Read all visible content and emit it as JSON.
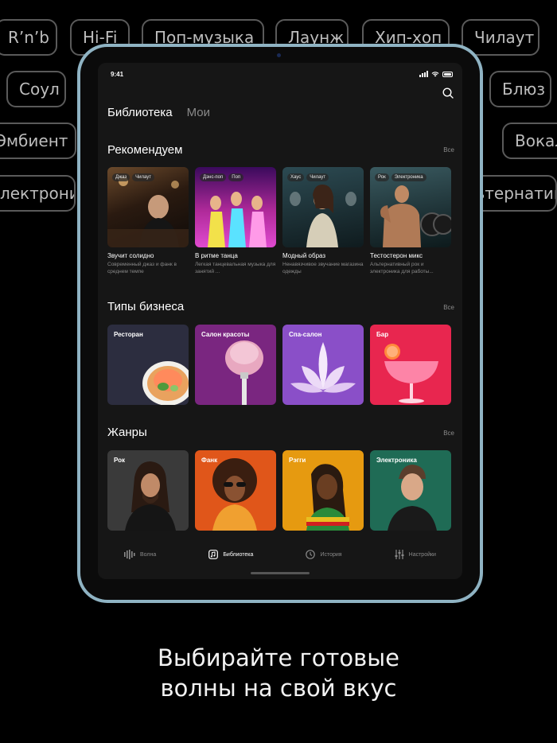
{
  "background_pills": [
    "R’n’b",
    "Hi-Fi",
    "Поп-музыка",
    "Лаунж",
    "Хип-хоп",
    "Чилаут",
    "Соул",
    "Блюз",
    "Эмбиент",
    "Вокал",
    "Электроника",
    "Альтернатива"
  ],
  "status_bar": {
    "time": "9:41"
  },
  "header": {
    "tab_active": "Библиотека",
    "tab_inactive": "Мои",
    "search_icon": "search-icon"
  },
  "recommend": {
    "title": "Рекомендуем",
    "all": "Все",
    "cards": [
      {
        "tags": [
          "Джаз",
          "Чилаут"
        ],
        "title": "Звучит солидно",
        "desc": "Современный джаз и фанк в среднем темпе"
      },
      {
        "tags": [
          "Дэнс-поп",
          "Поп"
        ],
        "title": "В ритме танца",
        "desc": "Легкая танцевальная музыка для занятий ..."
      },
      {
        "tags": [
          "Хаус",
          "Чилаут"
        ],
        "title": "Модный образ",
        "desc": "Ненавязчивое звучание магазина одежды"
      },
      {
        "tags": [
          "Рок",
          "Электроника"
        ],
        "title": "Тестостерон микс",
        "desc": "Альтернативный рок и электроника для работы..."
      }
    ]
  },
  "business": {
    "title": "Типы бизнеса",
    "all": "Все",
    "cards": [
      {
        "label": "Ресторан",
        "color": "#2c2d3f"
      },
      {
        "label": "Салон красоты",
        "color": "#7a2680"
      },
      {
        "label": "Спа-салон",
        "color": "#8a4fc8"
      },
      {
        "label": "Бар",
        "color": "#e8264f"
      }
    ]
  },
  "genres": {
    "title": "Жанры",
    "all": "Все",
    "cards": [
      {
        "label": "Рок",
        "color": "#3a3a3a"
      },
      {
        "label": "Фанк",
        "color": "#e0561a"
      },
      {
        "label": "Рэгги",
        "color": "#e69a10"
      },
      {
        "label": "Электроника",
        "color": "#1f6b55"
      }
    ]
  },
  "nav": {
    "items": [
      {
        "label": "Волна",
        "icon": "wave-icon"
      },
      {
        "label": "Библиотека",
        "icon": "library-icon"
      },
      {
        "label": "История",
        "icon": "clock-icon"
      },
      {
        "label": "Настройки",
        "icon": "sliders-icon"
      }
    ],
    "active": "Библиотека"
  },
  "caption": {
    "line1": "Выбирайте готовые",
    "line2": "волны на свой вкус"
  },
  "colors": {
    "tablet_frame": "#8fb3c3",
    "screen_bg": "#161616",
    "page_bg": "#000000"
  }
}
